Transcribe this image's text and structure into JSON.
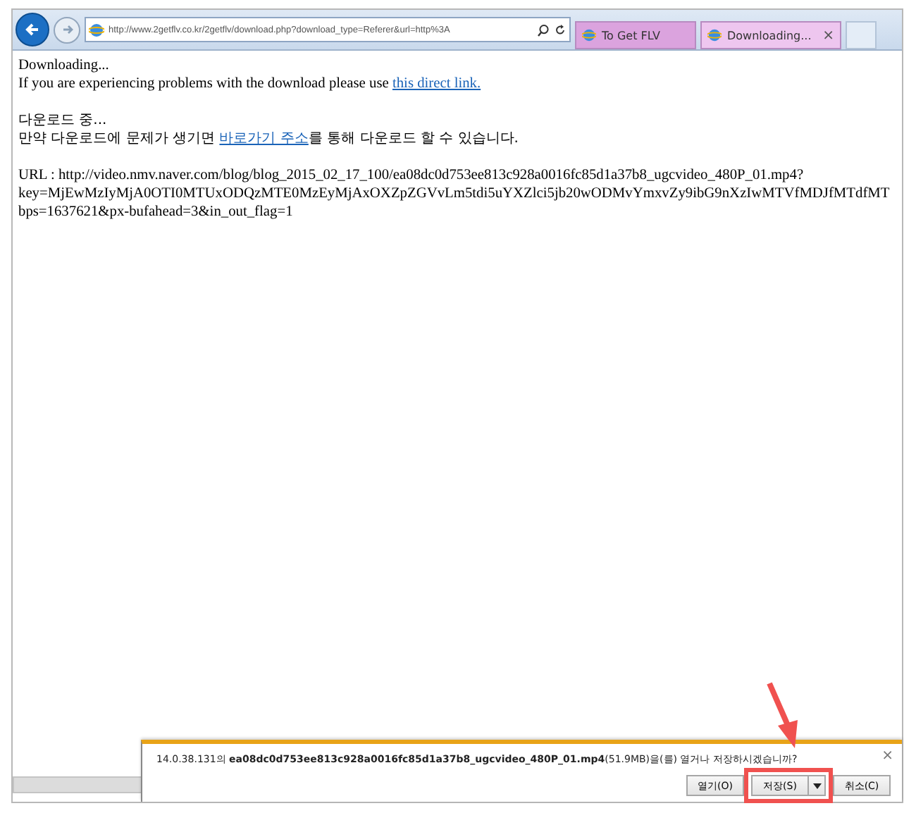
{
  "address_bar": {
    "url": "http://www.2getflv.co.kr/2getflv/download.php?download_type=Referer&url=http%3A"
  },
  "tabs": [
    {
      "label": "To Get FLV",
      "selected": false
    },
    {
      "label": "Downloading...",
      "selected": true,
      "close": "×"
    }
  ],
  "page": {
    "lines": [
      {
        "kind": "text",
        "text": "Downloading..."
      },
      {
        "kind": "link_line",
        "text": "If you are experiencing problems with the download please use ",
        "link": "this direct link."
      },
      {
        "kind": "gap"
      },
      {
        "kind": "text",
        "text": "다운로드 중..."
      },
      {
        "kind": "link_line",
        "text": "만약 다운로드에 문제가 생기면 ",
        "link": "바로가기 주소",
        "after": "를 통해 다운로드 할 수 있습니다."
      },
      {
        "kind": "gap"
      },
      {
        "kind": "text",
        "text": "URL : http://video.nmv.naver.com/blog/blog_2015_02_17_100/ea08dc0d753ee813c928a0016fc85d1a37b8_ugcvideo_480P_01.mp4?"
      },
      {
        "kind": "text",
        "text": "key=MjEwMzIyMjA0OTI0MTUxODQzMTE0MzEyMjAxOXZpZGVvLm5tdi5uYXZlci5jb20wODMvYmxvZy9ibG9nXzIwMTVfMDJfMTdfMT"
      },
      {
        "kind": "text",
        "text": "bps=1637621&px-bufahead=3&in_out_flag=1"
      }
    ]
  },
  "download_bar": {
    "message": "14.0.38.131의 **ea08dc0d753ee813c928a0016fc85d1a37b8_ugcvideo_480P_01.mp4**(51.9MB)을(를) 열거나 저장하시겠습니까?",
    "close": "×",
    "buttons": [
      {
        "kind": "plain",
        "label": "열기(O)"
      },
      {
        "kind": "split",
        "label": "저장(S)",
        "highlighted": true
      },
      {
        "kind": "plain",
        "label": "취소(C)"
      }
    ]
  }
}
